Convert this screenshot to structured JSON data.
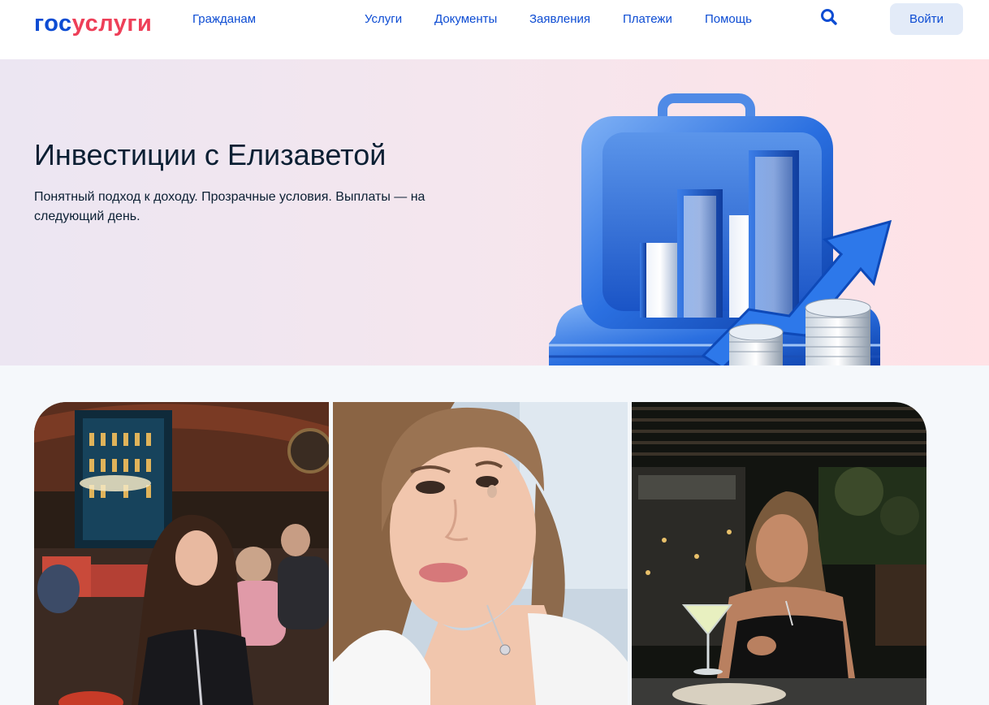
{
  "header": {
    "logo_part1": "гос",
    "logo_part2": "услуги",
    "citizens_link": "Гражданам",
    "nav": [
      "Услуги",
      "Документы",
      "Заявления",
      "Платежи",
      "Помощь"
    ],
    "search_icon": "search-icon",
    "login_label": "Войти"
  },
  "hero": {
    "title": "Инвестиции с Елизаветой",
    "subtitle": "Понятный подход к доходу. Прозрачные условия. Выплаты — на следующий день.",
    "illustration": "briefcase-chart-coins"
  },
  "gallery": {
    "photos": [
      "photo-restaurant-bar",
      "photo-selfie",
      "photo-terrace-cocktail"
    ]
  },
  "colors": {
    "brand_blue": "#0d4cd3",
    "brand_red": "#ee3f58",
    "text": "#0b1f33",
    "login_bg": "#e3ebf8"
  }
}
